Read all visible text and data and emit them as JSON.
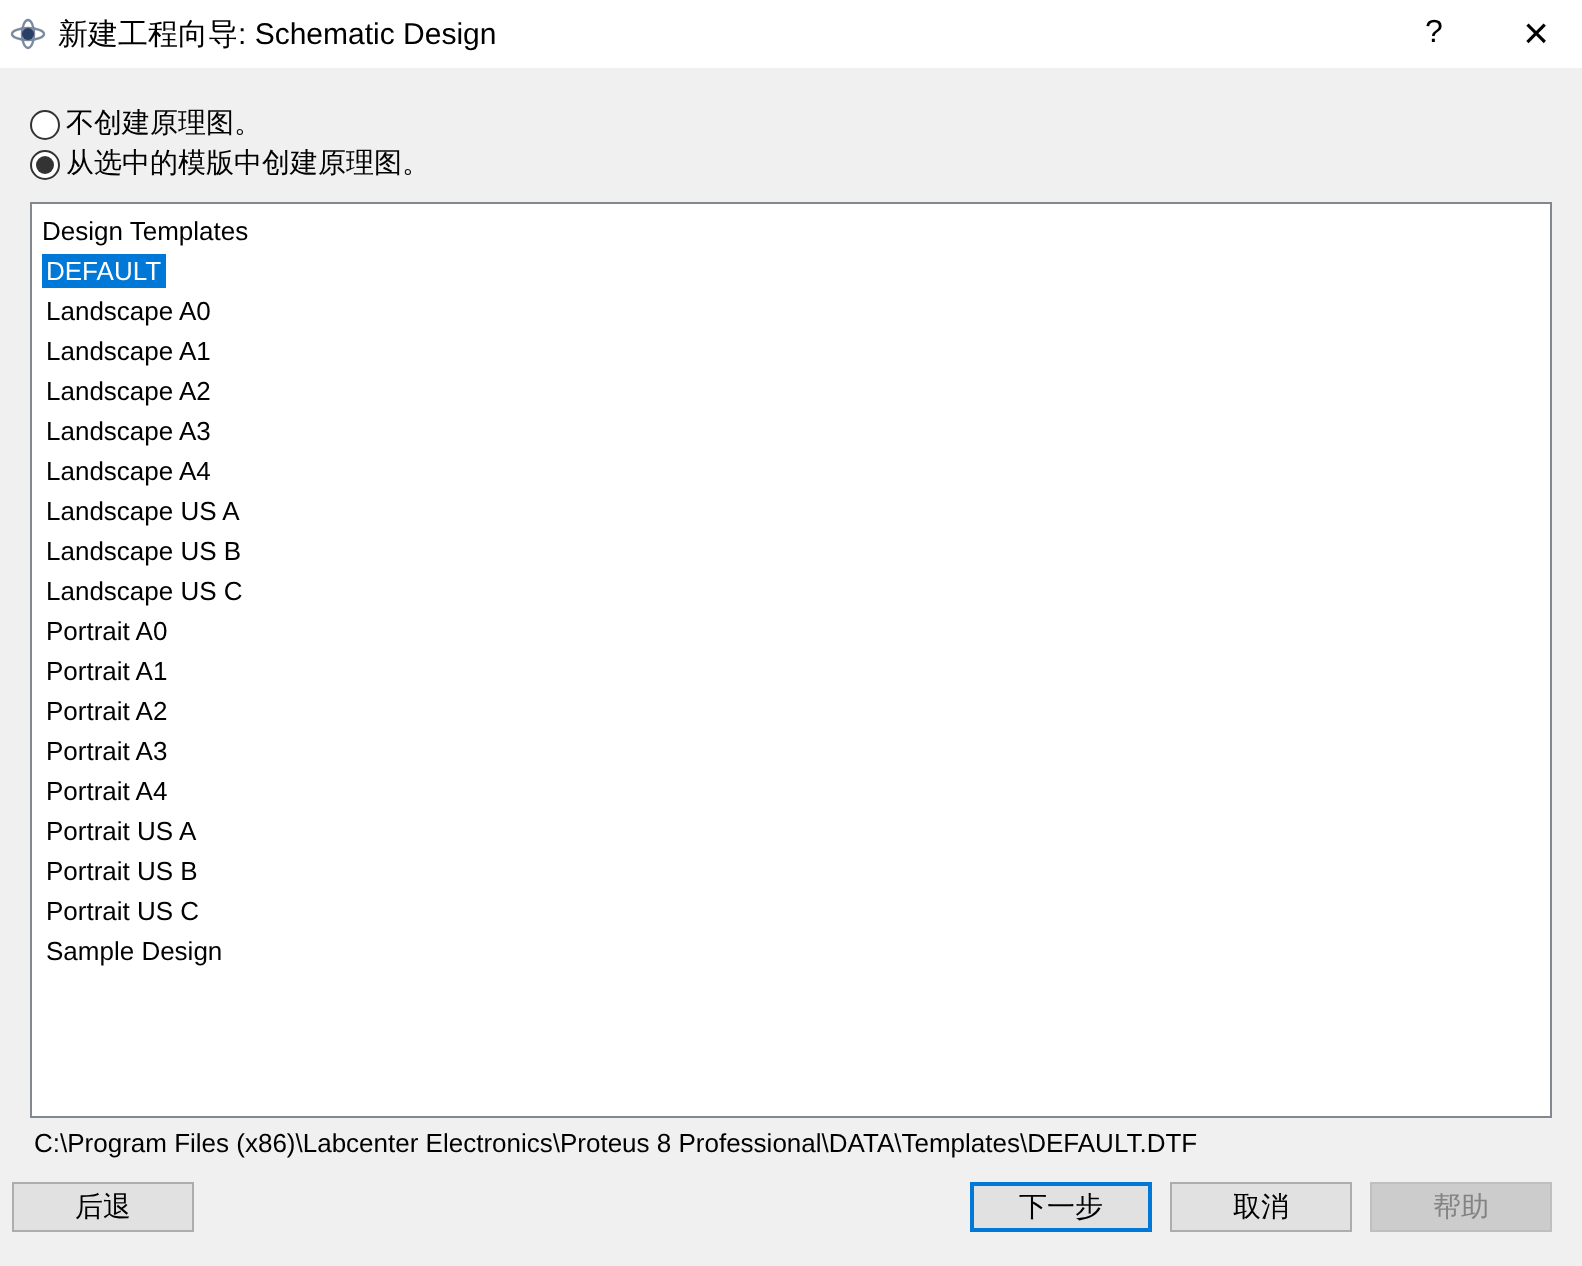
{
  "window": {
    "title": "新建工程向导: Schematic Design",
    "help": "?",
    "close": "×"
  },
  "options": [
    {
      "label": "不创建原理图。",
      "selected": false
    },
    {
      "label": "从选中的模版中创建原理图。",
      "selected": true
    }
  ],
  "templates": {
    "header": "Design Templates",
    "items": [
      {
        "label": "DEFAULT",
        "selected": true
      },
      {
        "label": "Landscape A0",
        "selected": false
      },
      {
        "label": "Landscape A1",
        "selected": false
      },
      {
        "label": "Landscape A2",
        "selected": false
      },
      {
        "label": "Landscape A3",
        "selected": false
      },
      {
        "label": "Landscape A4",
        "selected": false
      },
      {
        "label": "Landscape US A",
        "selected": false
      },
      {
        "label": "Landscape US B",
        "selected": false
      },
      {
        "label": "Landscape US C",
        "selected": false
      },
      {
        "label": "Portrait A0",
        "selected": false
      },
      {
        "label": "Portrait A1",
        "selected": false
      },
      {
        "label": "Portrait A2",
        "selected": false
      },
      {
        "label": "Portrait A3",
        "selected": false
      },
      {
        "label": "Portrait A4",
        "selected": false
      },
      {
        "label": "Portrait US A",
        "selected": false
      },
      {
        "label": "Portrait US B",
        "selected": false
      },
      {
        "label": "Portrait US C",
        "selected": false
      },
      {
        "label": "Sample Design",
        "selected": false
      }
    ]
  },
  "path": "C:\\Program Files (x86)\\Labcenter Electronics\\Proteus 8 Professional\\DATA\\Templates\\DEFAULT.DTF",
  "buttons": [
    {
      "label": "后退",
      "default": false,
      "disabled": false
    },
    {
      "label": "下一步",
      "default": true,
      "disabled": false
    },
    {
      "label": "取消",
      "default": false,
      "disabled": false
    },
    {
      "label": "帮助",
      "default": false,
      "disabled": true
    }
  ]
}
